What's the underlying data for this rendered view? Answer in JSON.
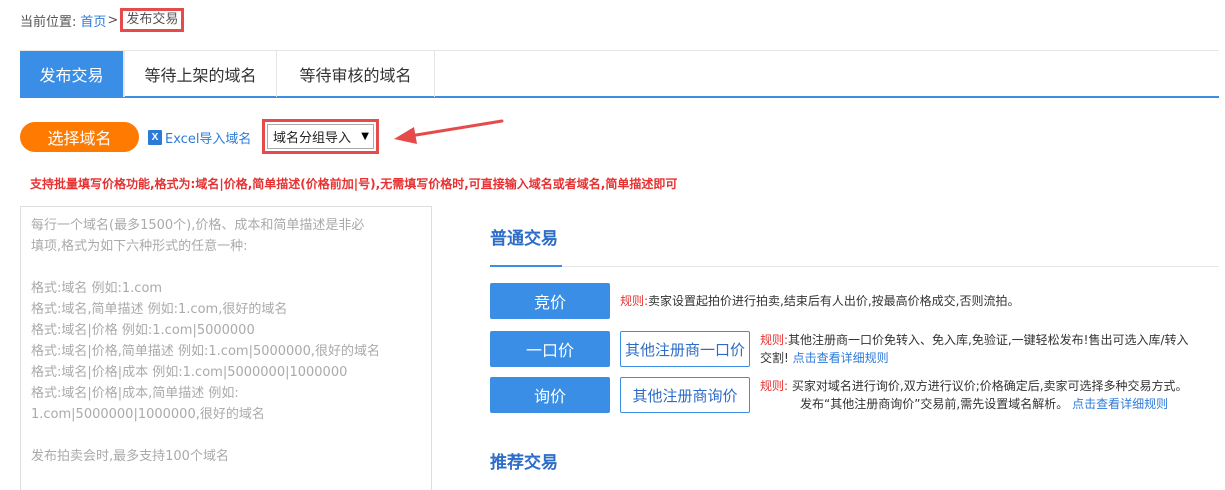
{
  "breadcrumb": {
    "label": "当前位置:",
    "home": "首页",
    "sep": ">",
    "current": "发布交易"
  },
  "tabs": [
    {
      "label": "发布交易",
      "active": true
    },
    {
      "label": "等待上架的域名",
      "active": false
    },
    {
      "label": "等待审核的域名",
      "active": false
    }
  ],
  "toolbar": {
    "select_label": "选择域名",
    "excel_icon": "excel-icon",
    "excel_label": "Excel导入域名",
    "group_select_value": "域名分组导入"
  },
  "hint": "支持批量填写价格功能,格式为:域名|价格,简单描述(价格前加|号),无需填写价格时,可直接输入域名或者域名,简单描述即可",
  "textarea_placeholder": {
    "lines1": [
      "每行一个域名(最多1500个),价格、成本和简单描述是非必",
      "填项,格式为如下六种形式的任意一种:"
    ],
    "lines2": [
      "格式:域名 例如:1.com",
      "格式:域名,简单描述 例如:1.com,很好的域名",
      "格式:域名|价格 例如:1.com|5000000",
      "格式:域名|价格,简单描述 例如:1.com|5000000,很好的域名",
      "格式:域名|价格|成本 例如:1.com|5000000|1000000",
      "格式:域名|价格|成本,简单描述 例如:",
      "1.com|5000000|1000000,很好的域名"
    ],
    "lines3": [
      "发布拍卖会时,最多支持100个域名"
    ]
  },
  "normal_trade": {
    "title": "普通交易",
    "auction": {
      "button": "竞价",
      "rule_label": "规则:",
      "rule_text": "卖家设置起拍价进行拍卖,结束后有人出价,按最高价格成交,否则流拍。"
    },
    "fixed": {
      "button": "一口价",
      "other_button": "其他注册商一口价",
      "rule_label": "规则:",
      "rule_text1": "其他注册商一口价免转入、免入库,免验证,一键轻松发布!售出可选入库/转入",
      "rule_text2": "交割!",
      "rule_link": "点击查看详细规则"
    },
    "inquiry": {
      "button": "询价",
      "other_button": "其他注册商询价",
      "rule_label": "规则:",
      "rule_text1": "买家对域名进行询价,双方进行议价;价格确定后,卖家可选择多种交易方式。",
      "rule_text2": "发布“其他注册商询价”交易前,需先设置域名解析。",
      "rule_link": "点击查看详细规则"
    }
  },
  "recommend_trade": {
    "title": "推荐交易"
  },
  "colors": {
    "primary": "#3a8ee6",
    "orange": "#ff7a00",
    "red": "#e63232",
    "highlight_box": "#e64b4b"
  }
}
